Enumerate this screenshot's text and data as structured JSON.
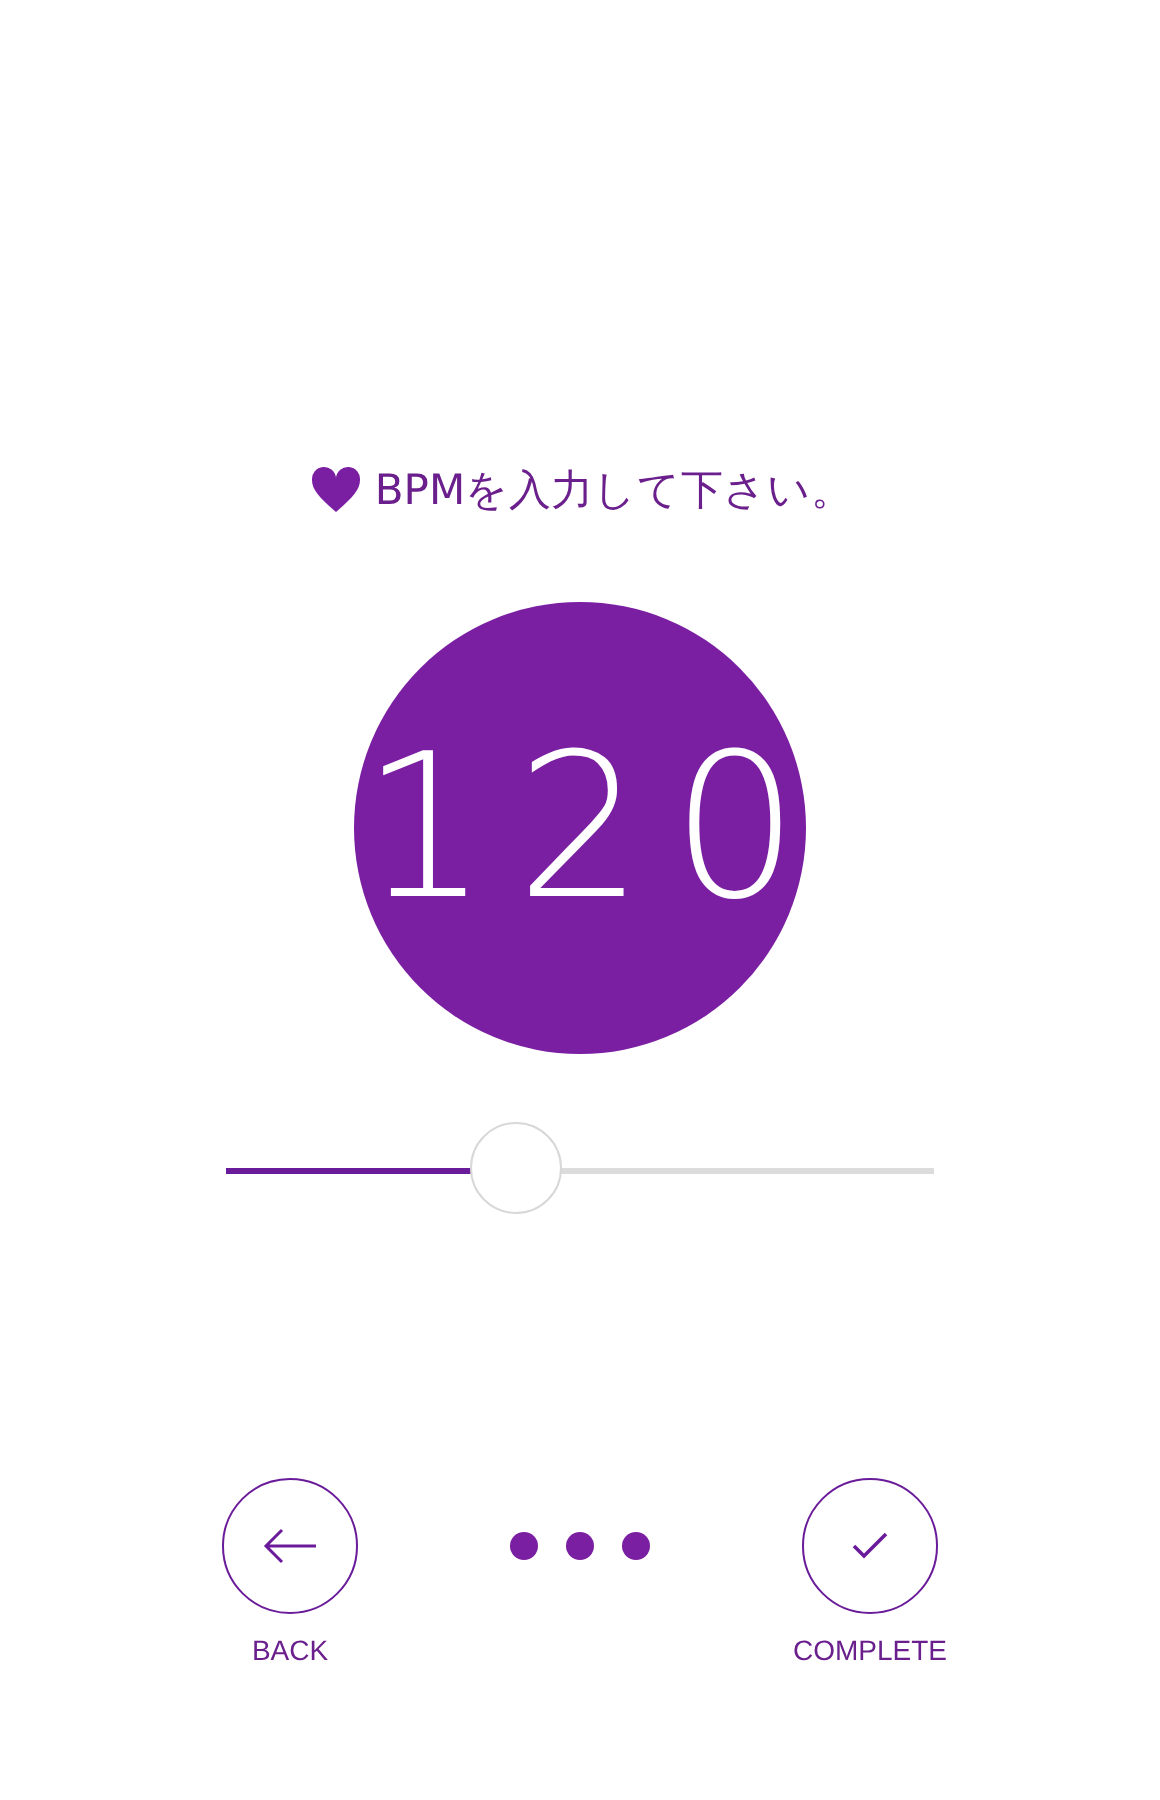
{
  "prompt": {
    "text": "BPMを入力して下さい。"
  },
  "bpm": {
    "value": "120"
  },
  "slider": {
    "level": 0.41
  },
  "buttons": [
    {
      "kind": "back",
      "label": "BACK"
    },
    {
      "kind": "complete",
      "label": "COMPLETE"
    }
  ]
}
